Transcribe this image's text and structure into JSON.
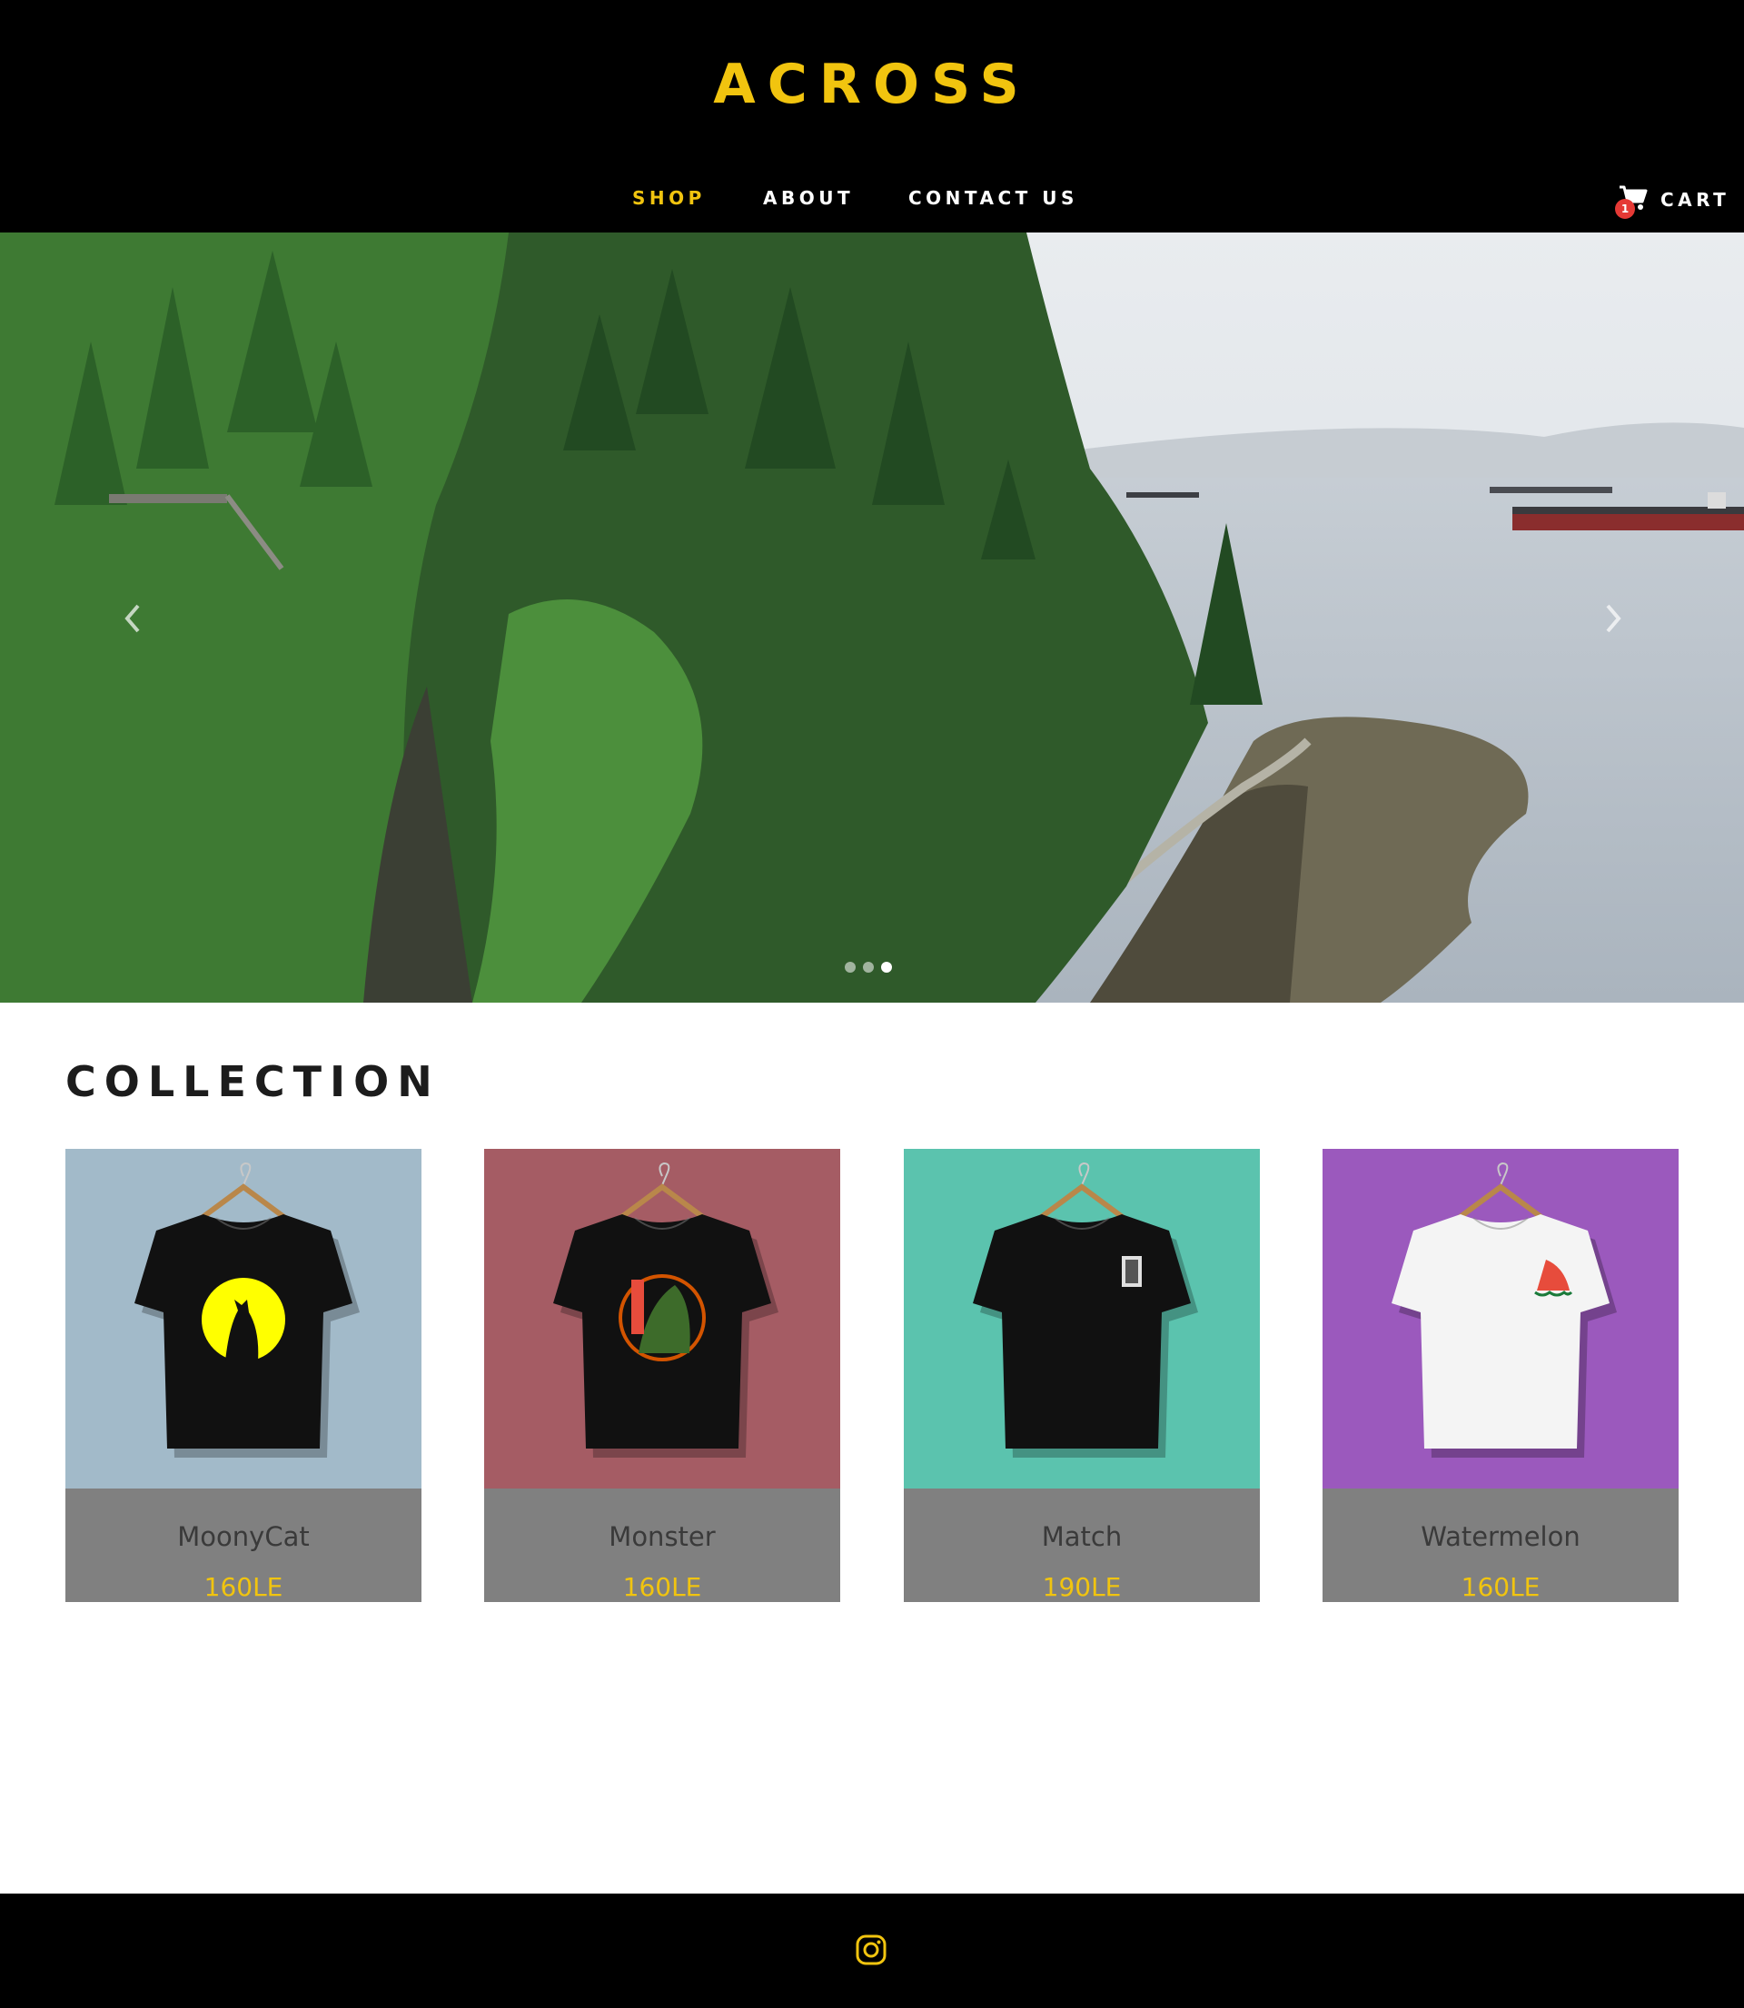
{
  "header": {
    "logo": "ACROSS",
    "nav": [
      {
        "label": "SHOP",
        "active": true
      },
      {
        "label": "ABOUT",
        "active": false
      },
      {
        "label": "CONTACT US",
        "active": false
      }
    ],
    "cart": {
      "label": "CART",
      "count": "1"
    }
  },
  "hero": {
    "slide_count": 3,
    "active_slide": 3
  },
  "collection": {
    "title": "COLLECTION",
    "products": [
      {
        "name": "MoonyCat",
        "price": "160LE",
        "bg_color": "#a2bac9",
        "shirt_color": "#111111",
        "icon": "tshirt-moon-cat-icon"
      },
      {
        "name": "Monster",
        "price": "160LE",
        "bg_color": "#a55c64",
        "shirt_color": "#111111",
        "icon": "tshirt-monster-icon"
      },
      {
        "name": "Match",
        "price": "190LE",
        "bg_color": "#5bc3ae",
        "shirt_color": "#111111",
        "icon": "tshirt-match-icon"
      },
      {
        "name": "Watermelon",
        "price": "160LE",
        "bg_color": "#9b59bd",
        "shirt_color": "#f4f4f4",
        "icon": "tshirt-watermelon-icon"
      }
    ]
  },
  "footer": {
    "social_icon": "instagram-icon"
  },
  "colors": {
    "accent": "#f1c40f",
    "header_bg": "#000000",
    "card_info_bg": "#808080",
    "badge": "#e53935"
  }
}
